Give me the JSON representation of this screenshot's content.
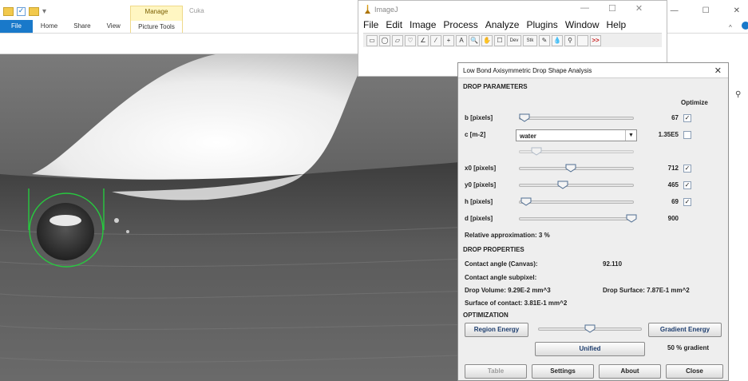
{
  "explorer": {
    "tabs": [
      "File",
      "Home",
      "Share",
      "View",
      "Picture Tools"
    ],
    "manage_label": "Manage",
    "window_title": "Cuka",
    "ctrls": [
      "—",
      "☐",
      "✕"
    ]
  },
  "image_window": {
    "ctrls": [
      "—",
      "☐",
      "✕"
    ]
  },
  "imagej": {
    "title": "ImageJ",
    "menu": [
      "File",
      "Edit",
      "Image",
      "Process",
      "Analyze",
      "Plugins",
      "Window",
      "Help"
    ],
    "ctrls": [
      "—",
      "☐",
      "✕"
    ],
    "tools": [
      "▭",
      "◯",
      "▱",
      "♡",
      "∠",
      "⁄",
      "+",
      "A",
      "🔍",
      "✋",
      "☐",
      "Dev",
      "Stk",
      "✎",
      "💧",
      "⚲",
      "",
      ">>"
    ]
  },
  "dialog": {
    "title": "Low Bond Axisymmetric Drop Shape Analysis",
    "close": "✕",
    "drop_parameters_heading": "DROP PARAMETERS",
    "optimize_label": "Optimize",
    "params": [
      {
        "label": "b [pixels]",
        "value": "67",
        "checked": true,
        "slider": 0.05
      },
      {
        "label": "c [m-2]",
        "value": "1.35E5",
        "checked": false,
        "combo": "water",
        "slider": 0.15
      },
      {
        "label": "x0 [pixels]",
        "value": "712",
        "checked": true,
        "slider": 0.45
      },
      {
        "label": "y0 [pixels]",
        "value": "465",
        "checked": true,
        "slider": 0.38
      },
      {
        "label": "h [pixels]",
        "value": "69",
        "checked": true,
        "slider": 0.06
      },
      {
        "label": "d [pixels]",
        "value": "900",
        "checked": false,
        "slider": 0.98
      }
    ],
    "relative_approx": "Relative approximation: 3 %",
    "drop_properties_heading": "DROP PROPERTIES",
    "contact_angle_label": "Contact angle (Canvas):",
    "contact_angle_value": "92.110",
    "contact_angle_subpixel": "Contact angle subpixel:",
    "drop_volume": "Drop Volume: 9.29E-2 mm^3",
    "drop_surface": "Drop Surface: 7.87E-1 mm^2",
    "surface_contact": "Surface of contact: 3.81E-1 mm^2",
    "optimization_heading": "OPTIMIZATION",
    "region_energy": "Region Energy",
    "gradient_energy": "Gradient Energy",
    "optimization_slider": 0.5,
    "unified": "Unified",
    "gradient_pct": "50 % gradient",
    "buttons": [
      "Table",
      "Settings",
      "About",
      "Close"
    ]
  }
}
